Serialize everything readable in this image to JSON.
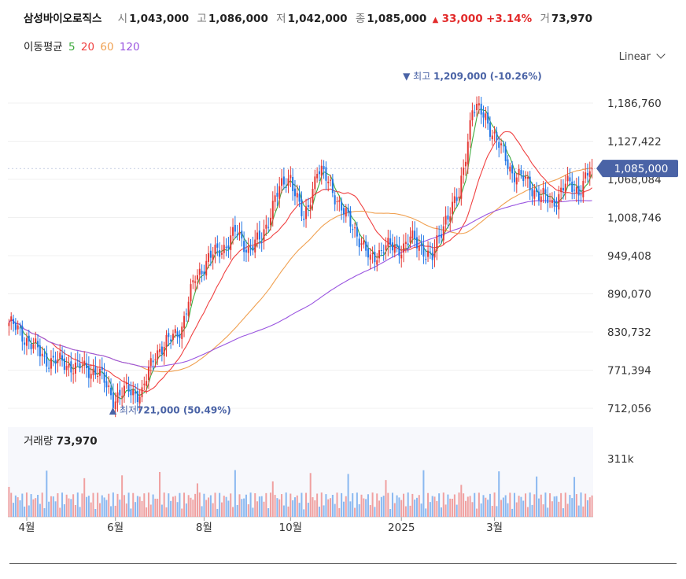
{
  "header": {
    "name": "삼성바이오로직스",
    "open_label": "시",
    "open": "1,043,000",
    "high_label": "고",
    "high": "1,086,000",
    "low_label": "저",
    "low": "1,042,000",
    "close_label": "종",
    "close": "1,085,000",
    "change_arrow": "▲",
    "change": "33,000",
    "change_pct": "+3.14%",
    "volume_label": "거",
    "volume": "73,970"
  },
  "moving_avg": {
    "label": "이동평균",
    "periods": [
      {
        "text": "5",
        "color": "#3daa3d"
      },
      {
        "text": "20",
        "color": "#f04040"
      },
      {
        "text": "60",
        "color": "#f0a050"
      },
      {
        "text": "120",
        "color": "#9a55e0"
      }
    ]
  },
  "scale_selector": {
    "label": "Linear",
    "icon": "chevron-down-icon"
  },
  "colors": {
    "up": "#e53935",
    "down": "#1e74e6",
    "price_tag": "#4a63a6",
    "volume_up": "#f0a0a0",
    "volume_down": "#8ab8f0"
  },
  "chart_data": {
    "type": "candlestick",
    "y_ticks": [
      "1,186,760",
      "1,127,422",
      "1,068,084",
      "1,008,746",
      "949,408",
      "890,070",
      "830,732",
      "771,394",
      "712,056"
    ],
    "y_tick_values": [
      1186760,
      1127422,
      1068084,
      1008746,
      949408,
      890070,
      830732,
      771394,
      712056
    ],
    "x_ticks": [
      "4월",
      "6월",
      "8월",
      "10월",
      "2025",
      "3월"
    ],
    "x_tick_index": [
      8,
      48,
      88,
      127,
      177,
      219
    ],
    "current_price_label": "1,085,000",
    "current_price": 1085000,
    "max_annotation": {
      "arrow": "▼",
      "label": "최고",
      "value": "1,209,000",
      "pct": "(-10.26%)",
      "index": 209,
      "price": 1209000
    },
    "min_annotation": {
      "arrow": "▲",
      "label": "최저",
      "value": "721,000",
      "pct": "(50.49%)",
      "index": 47,
      "price": 721000
    },
    "volume_title": "거래량",
    "volume_value": "73,970",
    "volume_tick": "311k",
    "volume_tick_value": 311000,
    "price_keypoints": [
      [
        0,
        845000
      ],
      [
        8,
        820000
      ],
      [
        16,
        790000
      ],
      [
        24,
        782000
      ],
      [
        32,
        775000
      ],
      [
        40,
        770000
      ],
      [
        47,
        728000
      ],
      [
        54,
        740000
      ],
      [
        60,
        735000
      ],
      [
        66,
        800000
      ],
      [
        72,
        815000
      ],
      [
        78,
        840000
      ],
      [
        84,
        915000
      ],
      [
        90,
        945000
      ],
      [
        96,
        960000
      ],
      [
        102,
        985000
      ],
      [
        108,
        960000
      ],
      [
        114,
        975000
      ],
      [
        120,
        1040000
      ],
      [
        127,
        1075000
      ],
      [
        133,
        1000000
      ],
      [
        139,
        1085000
      ],
      [
        145,
        1060000
      ],
      [
        151,
        1015000
      ],
      [
        157,
        985000
      ],
      [
        163,
        940000
      ],
      [
        169,
        965000
      ],
      [
        175,
        958000
      ],
      [
        181,
        975000
      ],
      [
        187,
        960000
      ],
      [
        191,
        945000
      ],
      [
        197,
        1010000
      ],
      [
        203,
        1040000
      ],
      [
        209,
        1180000
      ],
      [
        215,
        1165000
      ],
      [
        221,
        1120000
      ],
      [
        227,
        1080000
      ],
      [
        233,
        1065000
      ],
      [
        239,
        1045000
      ],
      [
        245,
        1030000
      ],
      [
        251,
        1060000
      ],
      [
        257,
        1052000
      ],
      [
        263,
        1085000
      ]
    ]
  }
}
